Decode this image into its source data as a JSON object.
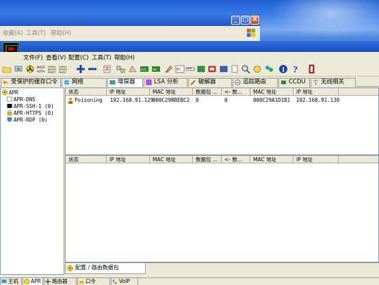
{
  "back_window": {
    "menu": [
      "收藏(A)",
      "工具(T)",
      "帮助(H)"
    ],
    "min_label": "_",
    "max_label": "□",
    "close_label": "X"
  },
  "menu": [
    "文件(F)",
    "查看(V)",
    "配置(C)",
    "工具(T)",
    "帮助(H)"
  ],
  "toolbar_icons": [
    "open-folder-icon",
    "network-icon",
    "sniffer-icon",
    "arp-auth-icon",
    "chall-spoof-icon",
    "chall-spoof-reset-icon",
    "add-icon",
    "remove-icon",
    "hash-icon",
    "bssid-icon",
    "network-map-icon",
    "ccdu-icon",
    "wireless-icon",
    "lsa-icon",
    "certificate-icon",
    "dots-icon",
    "green-box-icon",
    "red-box-icon",
    "blue-box-icon",
    "dictionary-icon",
    "search-icon",
    "stats-icon",
    "users-icon",
    "info-icon",
    "help-icon",
    "exit-icon"
  ],
  "top_tabs": [
    {
      "label": "受保护的缓存口令",
      "icon": "key-icon"
    },
    {
      "label": "网络",
      "icon": "globe-icon"
    },
    {
      "label": "嗅探器",
      "icon": "sniffer-icon"
    },
    {
      "label": "LSA 分析",
      "icon": "lsa-icon"
    },
    {
      "label": "破解器",
      "icon": "cracker-icon"
    },
    {
      "label": "追踪路由",
      "icon": "traceroute-icon"
    },
    {
      "label": "CCDU",
      "icon": "ccdu-icon"
    },
    {
      "label": "无线相关",
      "icon": "wireless-icon"
    }
  ],
  "tree": [
    {
      "label": "APR",
      "icon": "radiation-icon"
    },
    {
      "label": "APR-DNS",
      "icon": "dns-icon"
    },
    {
      "label": "APR-SSH-1 (0)",
      "icon": "terminal-icon"
    },
    {
      "label": "APR-HTTPS (0)",
      "icon": "lock-icon"
    },
    {
      "label": "APR-RDP (0)",
      "icon": "computer-icon"
    }
  ],
  "table_columns": [
    "状态",
    "IP 地址",
    "MAC 地址",
    "数据包 ...",
    "<- 数...",
    "MAC 地址",
    "IP 地址"
  ],
  "top_rows": [
    {
      "status": "Poisoning",
      "ip1": "192.168.91.129",
      "mac1": "000C29BBEBC2",
      "packets_out": "0",
      "packets_in": "0",
      "mac2": "000C29A1D1B1",
      "ip2": "192.168.91.130"
    }
  ],
  "bottom_tab": "配置 / 路由数据包",
  "status_tabs": [
    {
      "label": "主机",
      "icon": "host-icon"
    },
    {
      "label": "APR",
      "icon": "radiation-icon"
    },
    {
      "label": "路由器",
      "icon": "router-icon"
    },
    {
      "label": "口令",
      "icon": "password-icon"
    },
    {
      "label": "VoIP",
      "icon": "voip-icon"
    }
  ]
}
